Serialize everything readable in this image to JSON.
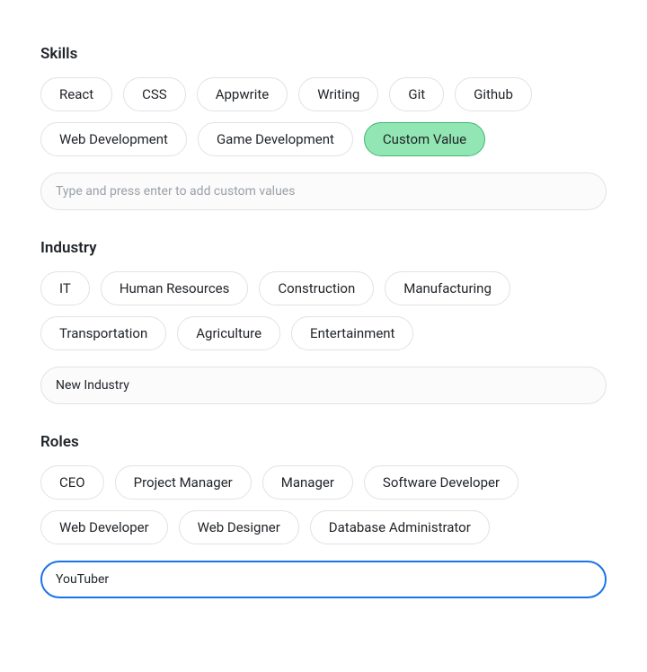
{
  "sections": {
    "skills": {
      "title": "Skills",
      "chips": [
        {
          "label": "React",
          "selected": false
        },
        {
          "label": "CSS",
          "selected": false
        },
        {
          "label": "Appwrite",
          "selected": false
        },
        {
          "label": "Writing",
          "selected": false
        },
        {
          "label": "Git",
          "selected": false
        },
        {
          "label": "Github",
          "selected": false
        },
        {
          "label": "Web Development",
          "selected": false
        },
        {
          "label": "Game Development",
          "selected": false
        },
        {
          "label": "Custom Value",
          "selected": true
        }
      ],
      "input": {
        "value": "",
        "placeholder": "Type and press enter to add custom values",
        "focused": false
      }
    },
    "industry": {
      "title": "Industry",
      "chips": [
        {
          "label": "IT",
          "selected": false
        },
        {
          "label": "Human Resources",
          "selected": false
        },
        {
          "label": "Construction",
          "selected": false
        },
        {
          "label": "Manufacturing",
          "selected": false
        },
        {
          "label": "Transportation",
          "selected": false
        },
        {
          "label": "Agriculture",
          "selected": false
        },
        {
          "label": "Entertainment",
          "selected": false
        }
      ],
      "input": {
        "value": "New Industry",
        "placeholder": "",
        "focused": false
      }
    },
    "roles": {
      "title": "Roles",
      "chips": [
        {
          "label": "CEO",
          "selected": false
        },
        {
          "label": "Project Manager",
          "selected": false
        },
        {
          "label": "Manager",
          "selected": false
        },
        {
          "label": "Software Developer",
          "selected": false
        },
        {
          "label": "Web Developer",
          "selected": false
        },
        {
          "label": "Web Designer",
          "selected": false
        },
        {
          "label": "Database Administrator",
          "selected": false
        }
      ],
      "input": {
        "value": "YouTuber",
        "placeholder": "",
        "focused": true
      }
    }
  }
}
